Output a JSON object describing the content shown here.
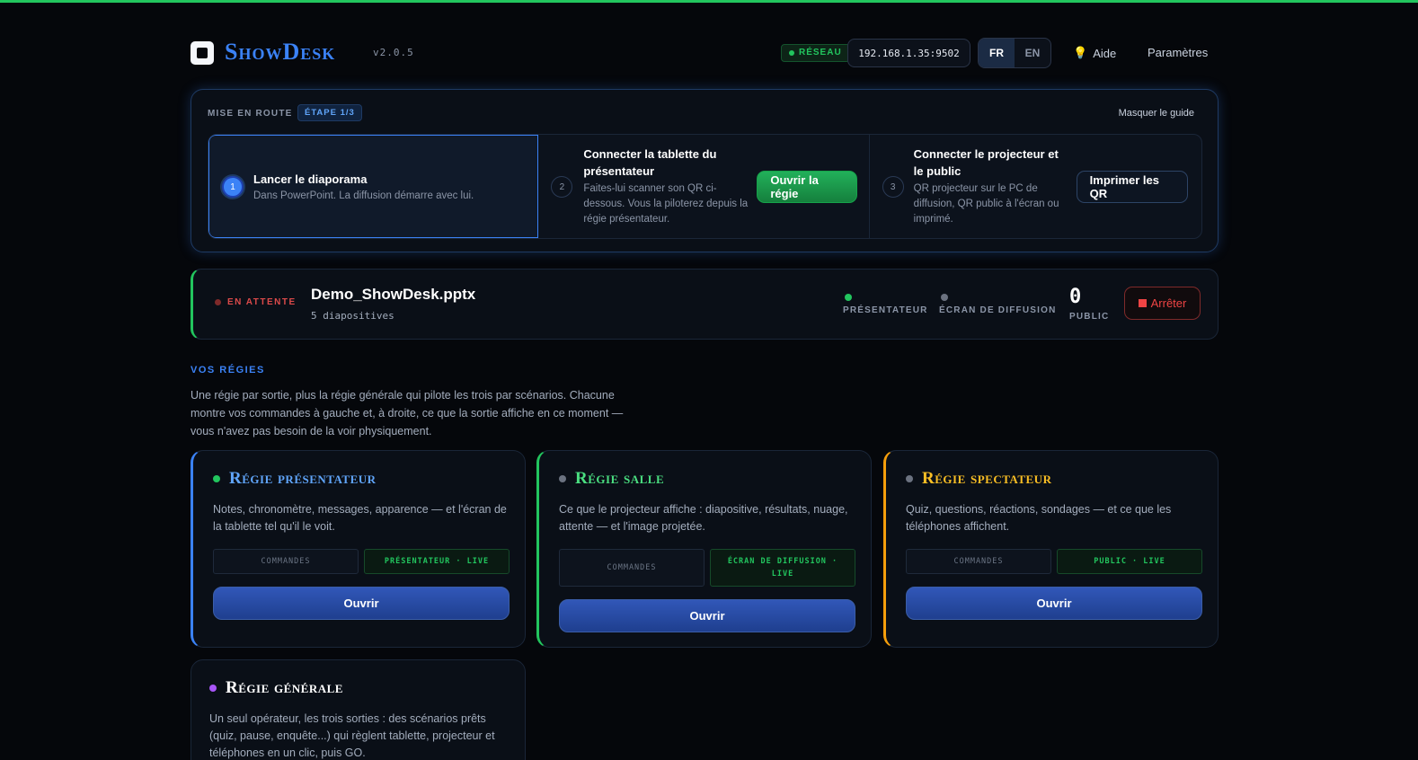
{
  "header": {
    "brand": "ShowDesk",
    "version": "v2.0.5",
    "network_badge": "RÉSEAU",
    "ip": "192.168.1.35:9502",
    "languages": [
      "FR",
      "EN"
    ],
    "active_language": "FR",
    "help_label": "Aide",
    "settings_label": "Paramètres"
  },
  "guide": {
    "title": "MISE EN ROUTE",
    "step_badge": "ÉTAPE 1/3",
    "hide_label": "Masquer le guide",
    "steps": [
      {
        "number": "1",
        "title": "Lancer le diaporama",
        "description": "Dans PowerPoint. La diffusion démarre avec lui."
      },
      {
        "number": "2",
        "title": "Connecter la tablette du présentateur",
        "description": "Faites-lui scanner son QR ci-dessous. Vous la piloterez depuis la régie présentateur.",
        "button": "Ouvrir la régie"
      },
      {
        "number": "3",
        "title": "Connecter le projecteur et le public",
        "description": "QR projecteur sur le PC de diffusion, QR public à l'écran ou imprimé.",
        "button": "Imprimer les QR"
      }
    ]
  },
  "status": {
    "state": "EN ATTENTE",
    "file_name": "Demo_ShowDesk.pptx",
    "slides": "5 diapositives",
    "presenter_label": "PRÉSENTATEUR",
    "screen_label": "ÉCRAN DE DIFFUSION",
    "public_count": "0",
    "public_label": "PUBLIC",
    "stop_label": "Arrêter"
  },
  "regies": {
    "title": "VOS RÉGIES",
    "description": "Une régie par sortie, plus la régie générale qui pilote les trois par scénarios. Chacune montre vos commandes à gauche et, à droite, ce que la sortie affiche en ce moment — vous n'avez pas besoin de la voir physiquement.",
    "cards": [
      {
        "title": "Régie présentateur",
        "description": "Notes, chronomètre, messages, apparence — et l'écran de la tablette tel qu'il le voit.",
        "chip_commands": "COMMANDES",
        "chip_live": "PRÉSENTATEUR · LIVE",
        "button": "Ouvrir"
      },
      {
        "title": "Régie salle",
        "description": "Ce que le projecteur affiche : diapositive, résultats, nuage, attente — et l'image projetée.",
        "chip_commands": "COMMANDES",
        "chip_live": "ÉCRAN DE DIFFUSION · LIVE",
        "button": "Ouvrir"
      },
      {
        "title": "Régie spectateur",
        "description": "Quiz, questions, réactions, sondages — et ce que les téléphones affichent.",
        "chip_commands": "COMMANDES",
        "chip_live": "PUBLIC · LIVE",
        "button": "Ouvrir"
      },
      {
        "title": "Régie générale",
        "description": "Un seul opérateur, les trois sorties : des scénarios prêts (quiz, pause, enquête...) qui règlent tablette, projecteur et téléphones en un clic, puis GO."
      }
    ]
  },
  "colors": {
    "top_line": "#22c55e",
    "brand": "#3b82f6",
    "presenter_accent": "#3b82f6",
    "salle_accent": "#22c55e",
    "spectateur_accent": "#f59e0b",
    "generale_accent": "#a855f7",
    "stop": "#ef4444"
  }
}
